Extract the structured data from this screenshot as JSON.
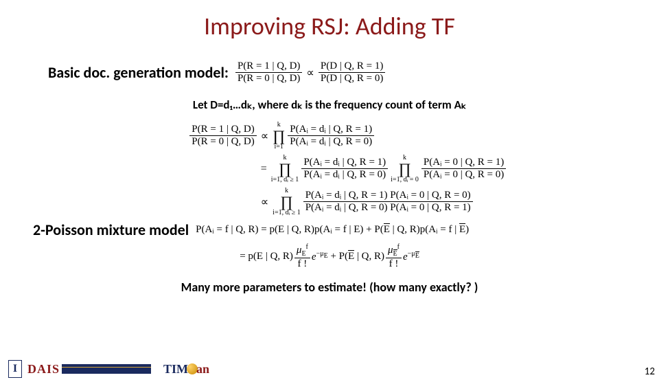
{
  "title": "Improving RSJ: Adding TF",
  "line1_label": "Basic doc. generation model:",
  "line2": "Let D=d₁…dₖ, where dₖ is the frequency count of term  Aₖ",
  "line3_label": "2-Poisson mixture model",
  "line5": "Many more parameters to estimate! (how many exactly? )",
  "page_number": "12",
  "logos": {
    "illinois": "I",
    "dais": "DAIS",
    "timan": "TIMan"
  },
  "math": {
    "eq1": {
      "lhs_num": "P(R = 1 | Q, D)",
      "lhs_den": "P(R = 0 | Q, D)",
      "prop": "∝",
      "rhs_num": "P(D | Q, R = 1)",
      "rhs_den": "P(D | Q, R = 0)"
    },
    "eq2_lhs": {
      "num": "P(R = 1 | Q, D)",
      "den": "P(R = 0 | Q, D)"
    },
    "eq2a": {
      "prop": "∝",
      "upper": "k",
      "lower": "i=1",
      "num": "P(Aᵢ = dᵢ | Q, R = 1)",
      "den": "P(Aᵢ = dᵢ | Q, R = 0)"
    },
    "eq2b": {
      "eq": "=",
      "prod1_upper": "k",
      "prod1_lower": "i=1, dᵢ ≥ 1",
      "frac1_num": "P(Aᵢ = dᵢ | Q, R = 1)",
      "frac1_den": "P(Aᵢ = dᵢ | Q, R = 0)",
      "prod2_upper": "k",
      "prod2_lower": "i=1, dᵢ = 0",
      "frac2_num": "P(Aᵢ = 0 | Q, R = 1)",
      "frac2_den": "P(Aᵢ = 0 | Q, R = 0)"
    },
    "eq2c": {
      "prop": "∝",
      "upper": "k",
      "lower": "i=1, dᵢ ≥ 1",
      "num": "P(Aᵢ = dᵢ | Q, R = 1) P(Aᵢ = 0 | Q, R = 0)",
      "den": "P(Aᵢ = dᵢ | Q, R = 0) P(Aᵢ = 0 | Q, R = 1)"
    },
    "mix_line1": {
      "lhs": "P(Aᵢ = f | Q, R)",
      "term1a": "p(E | Q, R)",
      "term1b": "p(Aᵢ = f | E)",
      "plus": "+",
      "term2a": "P(E̅ | Q, R)",
      "term2b": "p(Aᵢ = f | E̅)"
    },
    "mix_line2": {
      "eq": "=",
      "coef1": "p(E | Q, R)",
      "frac1_num_base": "μ",
      "frac1_num_sub": "E",
      "frac1_num_sup": "f",
      "frac1_den": "f !",
      "exp1": "e",
      "exp1_pow_base": "−μ",
      "exp1_pow_sub": "E",
      "plus": "+",
      "coef2": "P(E̅ | Q, R)",
      "frac2_num_base": "μ",
      "frac2_num_sub": "E̅",
      "frac2_num_sup": "f",
      "frac2_den": "f !",
      "exp2": "e",
      "exp2_pow_base": "−μ",
      "exp2_pow_sub": "E̅"
    }
  }
}
